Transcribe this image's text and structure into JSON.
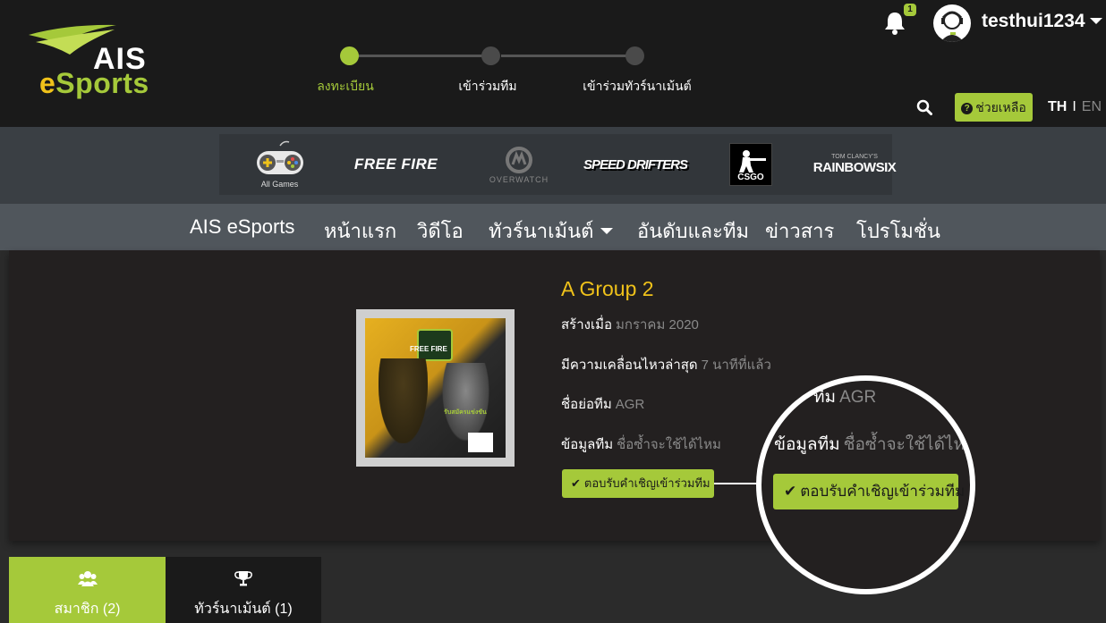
{
  "logo": {
    "line1": "AIS",
    "line2_e": "e",
    "line2_rest": "Sports"
  },
  "stepper": {
    "steps": [
      {
        "label": "ลงทะเบียน",
        "active": true
      },
      {
        "label": "เข้าร่วมทีม",
        "active": false
      },
      {
        "label": "เข้าร่วมทัวร์นาเม้นต์",
        "active": false
      }
    ]
  },
  "user": {
    "notification_count": "1",
    "username": "testhui1234"
  },
  "help": {
    "label": "ช่วยเหลือ",
    "icon": "?"
  },
  "language": {
    "th": "TH",
    "separator": "I",
    "en": "EN"
  },
  "games": {
    "all_games_label": "All Games",
    "free_fire": "FREE FIRE",
    "overwatch": "OVERWATCH",
    "speed_drifters": "SPEED DRIFTERS",
    "csgo": "CSGO",
    "rainbow_six": "RAINBOWSIX",
    "rainbow_six_sub": "TOM CLANCY'S"
  },
  "nav": {
    "items": [
      "AIS eSports",
      "หน้าแรก",
      "วิดีโอ",
      "ทัวร์นาเม้นต์",
      "อันดับและทีม",
      "ข่าวสาร",
      "โปรโมชั่น"
    ]
  },
  "team": {
    "name": "A Group 2",
    "created_label": "สร้างเมื่อ",
    "created_value": "มกราคม 2020",
    "last_active_label": "มีความเคลื่อนไหวล่าสุด",
    "last_active_value": "7 นาทีที่แล้ว",
    "short_name_label": "ชื่อย่อทีม",
    "short_name_value": "AGR",
    "info_label": "ข้อมูลทีม",
    "info_value": "ชื่อซ้ำจะใช้ได้ไหม",
    "accept_button": "ตอบรับคำเชิญเข้าร่วมทีม",
    "poster_free_fire": "FREE FIRE",
    "poster_sign": "รับสมัครแข่งขัน"
  },
  "zoom": {
    "short_name_label_partial": "ทีม",
    "short_name_value": "AGR",
    "info_label": "ข้อมูลทีม",
    "info_value": "ชื่อซ้ำจะใช้ได้ไหม",
    "accept_button": "ตอบรับคำเชิญเข้าร่วมทีม"
  },
  "tabs": [
    {
      "label": "สมาชิก (2)",
      "active": true,
      "icon": "users-icon"
    },
    {
      "label": "ทัวร์นาเม้นต์ (1)",
      "active": false,
      "icon": "trophy-icon"
    }
  ],
  "colors": {
    "accent": "#a5c93a",
    "team_name": "#f0c21a",
    "header_bg": "#1a1a1a"
  }
}
